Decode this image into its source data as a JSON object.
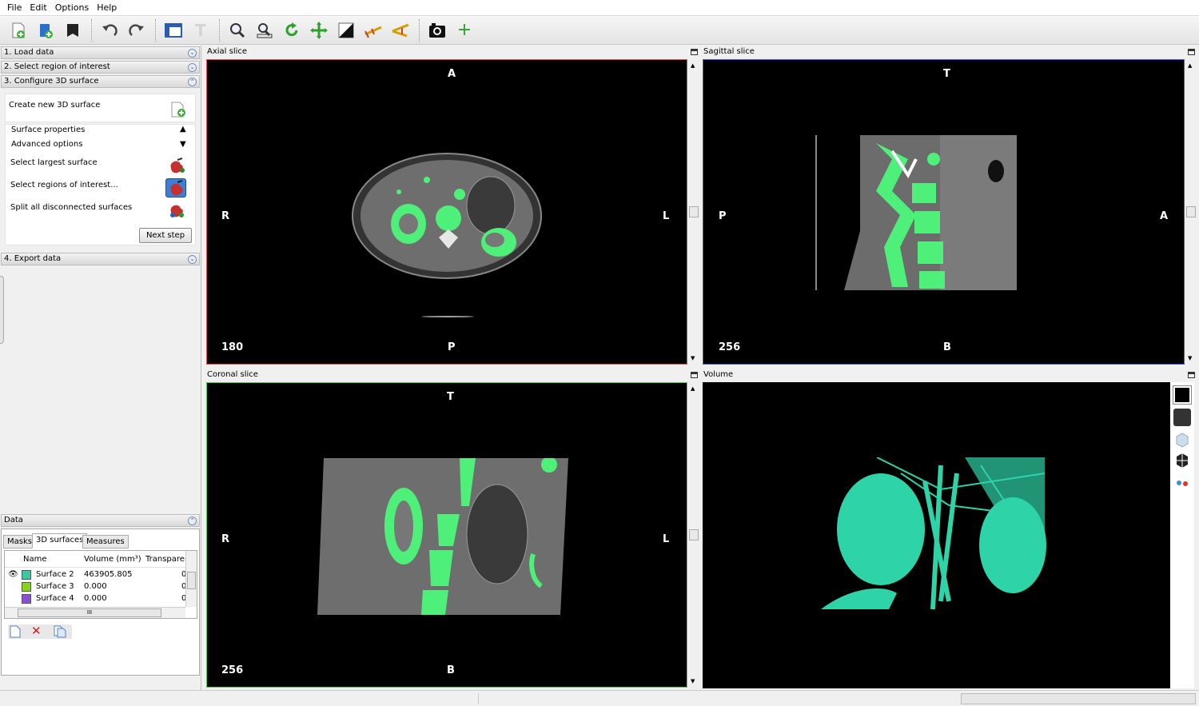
{
  "menu": [
    "File",
    "Edit",
    "Options",
    "Help"
  ],
  "toolbar": {
    "icons": [
      "import-icon",
      "open-project-icon",
      "save-icon",
      "undo-icon",
      "redo-icon",
      "layout-icon",
      "text-icon",
      "zoom-icon",
      "zoom-region-icon",
      "rotate-icon",
      "pan-icon",
      "contrast-icon",
      "linear-measure-icon",
      "angle-measure-icon",
      "screenshot-icon",
      "add-marker-icon"
    ]
  },
  "steps": {
    "load": "1. Load data",
    "select_roi": "2. Select region of interest",
    "configure": "3. Configure 3D surface",
    "export": "4. Export data"
  },
  "configure": {
    "create_new": "Create new 3D surface",
    "surface_properties": "Surface properties",
    "advanced_options": "Advanced options",
    "select_largest": "Select largest surface",
    "select_regions": "Select regions of interest...",
    "split_all": "Split all disconnected surfaces",
    "next_step": "Next step"
  },
  "data_panel": {
    "title": "Data",
    "tabs": [
      "Masks",
      "3D surfaces",
      "Measures"
    ],
    "columns": [
      "Name",
      "Volume (mm³)",
      "Transparen"
    ],
    "rows": [
      {
        "name": "Surface 2",
        "volume": "463905.805",
        "transparency": "0",
        "color": "#39c9a3"
      },
      {
        "name": "Surface 3",
        "volume": "0.000",
        "transparency": "0",
        "color": "#86d51b"
      },
      {
        "name": "Surface 4",
        "volume": "0.000",
        "transparency": "0",
        "color": "#8a4fd8"
      }
    ],
    "scroll_marker": "III"
  },
  "viewers": {
    "axial": {
      "title": "Axial slice",
      "top": "A",
      "bottom": "P",
      "left": "R",
      "right": "L",
      "slice": "180",
      "border": "#e05050"
    },
    "sagittal": {
      "title": "Sagittal slice",
      "top": "T",
      "bottom": "B",
      "left": "P",
      "right": "A",
      "slice": "256",
      "border": "#5050e0"
    },
    "coronal": {
      "title": "Coronal slice",
      "top": "T",
      "bottom": "B",
      "left": "R",
      "right": "L",
      "slice": "256",
      "border": "#50d050"
    },
    "volume": {
      "title": "Volume"
    }
  },
  "colors": {
    "mask_green": "#4ef07a",
    "surface_teal": "#2fd3a8"
  }
}
